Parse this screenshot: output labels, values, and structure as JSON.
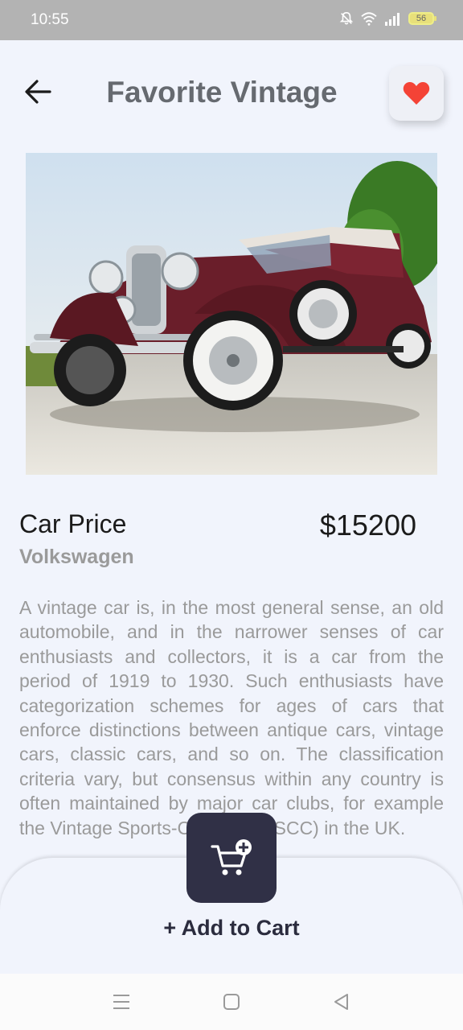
{
  "status_bar": {
    "time": "10:55",
    "battery": "56"
  },
  "header": {
    "title": "Favorite Vintage"
  },
  "product": {
    "price_label": "Car Price",
    "price": "$15200",
    "brand": "Volkswagen",
    "description": "A vintage car is, in the most general sense, an old automobile, and in the narrower senses of car enthusiasts and collectors, it is a car from the period of 1919 to 1930. Such enthusiasts have categorization schemes for ages of cars that enforce distinctions between antique cars, vintage cars, classic cars, and so on. The classification criteria vary, but consensus within any country is often maintained by major car clubs, for example the Vintage Sports-Car Club (VSCC) in the UK."
  },
  "cart": {
    "add_label": "+ Add to Cart"
  },
  "colors": {
    "accent": "#303046",
    "heart": "#f44336",
    "background": "#f1f4fc"
  },
  "icons": [
    "back-arrow-icon",
    "heart-icon",
    "cart-plus-icon",
    "menu-icon",
    "home-icon",
    "back-triangle-icon"
  ]
}
